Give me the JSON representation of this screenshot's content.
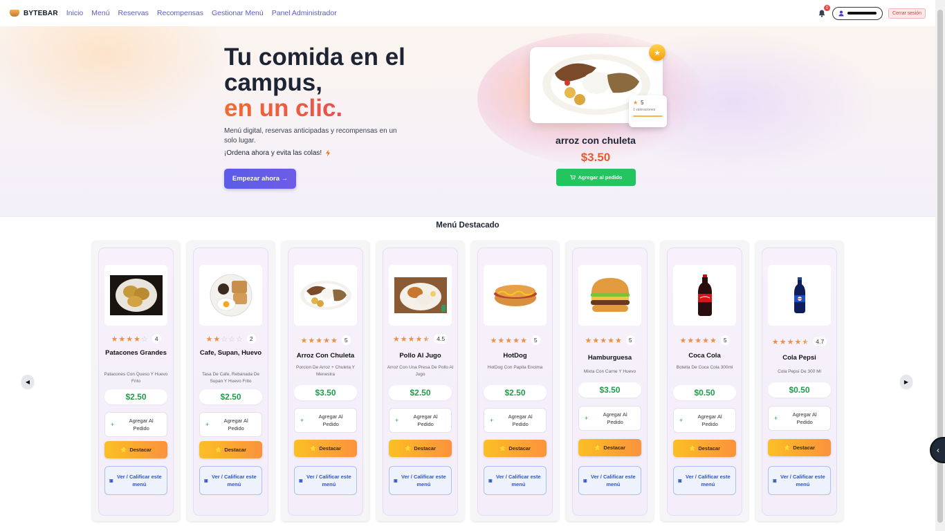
{
  "brand": {
    "name": "BYTEBAR"
  },
  "nav": {
    "links": [
      "Inicio",
      "Menú",
      "Reservas",
      "Recompensas",
      "Gestionar Menú",
      "Panel Administrador"
    ],
    "notification_count": "0",
    "logout_label": "Cerrar sesión"
  },
  "hero": {
    "title_line1": "Tu comida en el campus,",
    "title_accent": "en un clic.",
    "subtitle": "Menú digital, reservas anticipadas y recompensas en un solo lugar.",
    "cta_text": "¡Ordena ahora y evita las colas!",
    "start_button": "Empezar ahora →",
    "featured": {
      "rating": "5",
      "rating_count": "1 valoraciones",
      "name": "arroz con chuleta",
      "price": "$3.50",
      "add_button": "Agregar al pedido"
    }
  },
  "section": {
    "title": "Menú Destacado"
  },
  "card_buttons": {
    "add": "Agregar Al Pedido",
    "feature": "Destacar",
    "view": "Ver / Calificar este menú"
  },
  "products": [
    {
      "name": "Patacones Grandes",
      "desc": "Patacones Con Queso Y Huevo Frito",
      "price": "$2.50",
      "rating": "4",
      "stars": 4
    },
    {
      "name": "Cafe, Supan, Huevo",
      "desc": "Tasa De Cafe, Rebanada De Supan Y Huevo Frito",
      "price": "$2.50",
      "rating": "2",
      "stars": 2
    },
    {
      "name": "Arroz Con Chuleta",
      "desc": "Porcion De Arroz + Chuleta Y Menestra",
      "price": "$3.50",
      "rating": "5",
      "stars": 5
    },
    {
      "name": "Pollo Al Jugo",
      "desc": "Arroz Con Una Presa De Pollo Al Jugo",
      "price": "$2.50",
      "rating": "4.5",
      "stars": 4.5
    },
    {
      "name": "HotDog",
      "desc": "HotDog Con Papita Encima",
      "price": "$2.50",
      "rating": "5",
      "stars": 5
    },
    {
      "name": "Hamburguesa",
      "desc": "Mixta Con Carne Y Huevo",
      "price": "$3.50",
      "rating": "5",
      "stars": 5
    },
    {
      "name": "Coca Cola",
      "desc": "Botella De Coca Cola 300ml",
      "price": "$0.50",
      "rating": "5",
      "stars": 5
    },
    {
      "name": "Cola Pepsi",
      "desc": "Cola Pepsi De 300 Ml",
      "price": "$0.50",
      "rating": "4.7",
      "stars": 4.7
    }
  ],
  "colors": {
    "primary": "#5b5ce8",
    "price_green": "#1f9d4a",
    "accent_orange": "#ea5a2f",
    "add_green": "#22c55e"
  }
}
